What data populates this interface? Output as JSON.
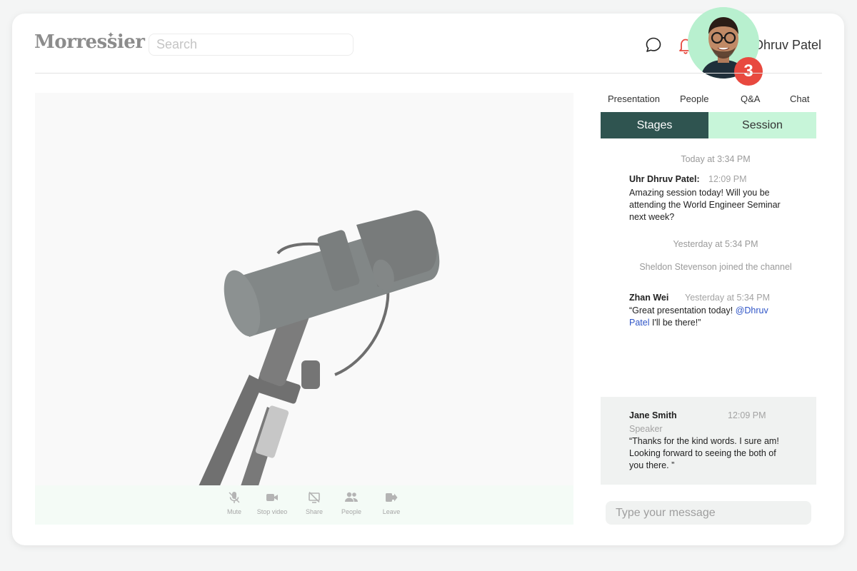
{
  "header": {
    "logo": "Morressier",
    "search_placeholder": "Search",
    "user_name": "Dhruv Patel",
    "notification_count": "3"
  },
  "controls": [
    {
      "label": "Mute",
      "icon": "mic-icon"
    },
    {
      "label": "Stop video",
      "icon": "video-camera-icon"
    },
    {
      "label": "Share",
      "icon": "screen-share-icon"
    },
    {
      "label": "People",
      "icon": "people-icon"
    },
    {
      "label": "Leave",
      "icon": "leave-icon"
    }
  ],
  "tabs": [
    "Presentation",
    "People",
    "Q&A",
    "Chat"
  ],
  "segments": {
    "stages": "Stages",
    "session": "Session"
  },
  "chat": {
    "sep1": "Today at 3:34 PM",
    "msg1": {
      "name": "Uhr Dhruv Patel:",
      "time": "12:09 PM",
      "text": "Amazing session today! Will you be attending the World Engineer Seminar next week?"
    },
    "sep2": "Yesterday at 5:34 PM",
    "join": "Sheldon Stevenson joined the channel",
    "msg2": {
      "name": "Zhan Wei",
      "time": "Yesterday at 5:34 PM",
      "text_before": "“Great presentation today! ",
      "mention": "@Dhruv Patel",
      "text_after": " I'll be there!”"
    },
    "speaker": {
      "name": "Jane Smith",
      "time": "12:09 PM",
      "role": "Speaker",
      "text": "“Thanks for the kind words. I sure am! Looking forward to seeing the both of you there. ”"
    },
    "input_placeholder": "Type your message"
  },
  "colors": {
    "stages_bg": "#2f5450",
    "session_bg": "#c7f5d9",
    "badge": "#e8493f",
    "mention": "#2f55c7",
    "bell": "#e8493f"
  }
}
